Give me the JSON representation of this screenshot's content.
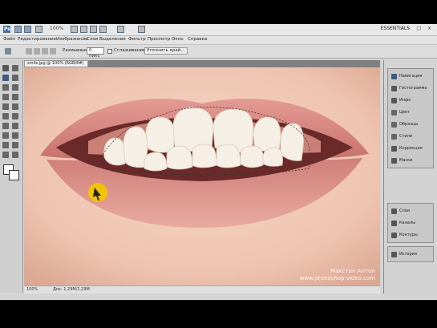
{
  "appbar": {
    "app_icon": "Ps",
    "zoom_value": "100%",
    "workspace_label": "ESSENTIALS",
    "window_buttons": "– □ ×"
  },
  "menu": {
    "items": [
      "Файл",
      "Редактирование",
      "Изображение",
      "Слои",
      "Выделение",
      "Фильтр",
      "Просмотр",
      "Окно",
      "Справка"
    ]
  },
  "options": {
    "label_tolerance": "Размывание:",
    "tolerance_value": "0 пикс",
    "antialias_label": "Сглаживание",
    "refine_edge_label": "Уточнить край..."
  },
  "document": {
    "tab_title": "smile.jpg @ 100% (RGB/8#)",
    "zoom_status": "100%",
    "doc_size": "Док: 1,29М/1,29М"
  },
  "watermark": {
    "line1": "Макстан Антон",
    "line2": "www.photoshop-video.com"
  },
  "panels": {
    "group1": [
      "Навигация",
      "Гистограмма",
      "Инфо",
      "Цвет",
      "Образцы",
      "Стили",
      "Коррекция",
      "Маски"
    ],
    "group2": [
      "Слои",
      "Каналы",
      "Контуры"
    ],
    "group3": [
      "История"
    ]
  },
  "colors": {
    "ps_blue": "#3b6fb6",
    "panel_bg": "#d3d3d3",
    "selection_marquee": "#333333"
  }
}
